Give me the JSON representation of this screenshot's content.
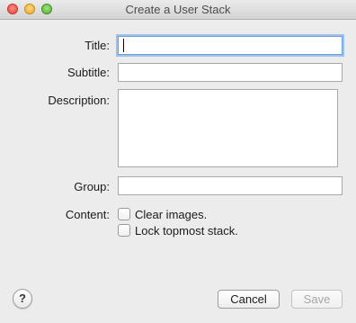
{
  "window": {
    "title": "Create a User Stack",
    "controls": [
      "close",
      "minimize",
      "zoom"
    ]
  },
  "form": {
    "title_label": "Title:",
    "title_value": "",
    "subtitle_label": "Subtitle:",
    "subtitle_value": "",
    "description_label": "Description:",
    "description_value": "",
    "group_label": "Group:",
    "group_value": "",
    "content_label": "Content:",
    "options": [
      {
        "label": "Clear images.",
        "checked": false
      },
      {
        "label": "Lock topmost stack.",
        "checked": false
      }
    ]
  },
  "footer": {
    "help_label": "?",
    "cancel_label": "Cancel",
    "save_label": "Save",
    "save_enabled": false
  },
  "colors": {
    "window_bg": "#ececec",
    "focus_ring": "#9dc1ea"
  }
}
